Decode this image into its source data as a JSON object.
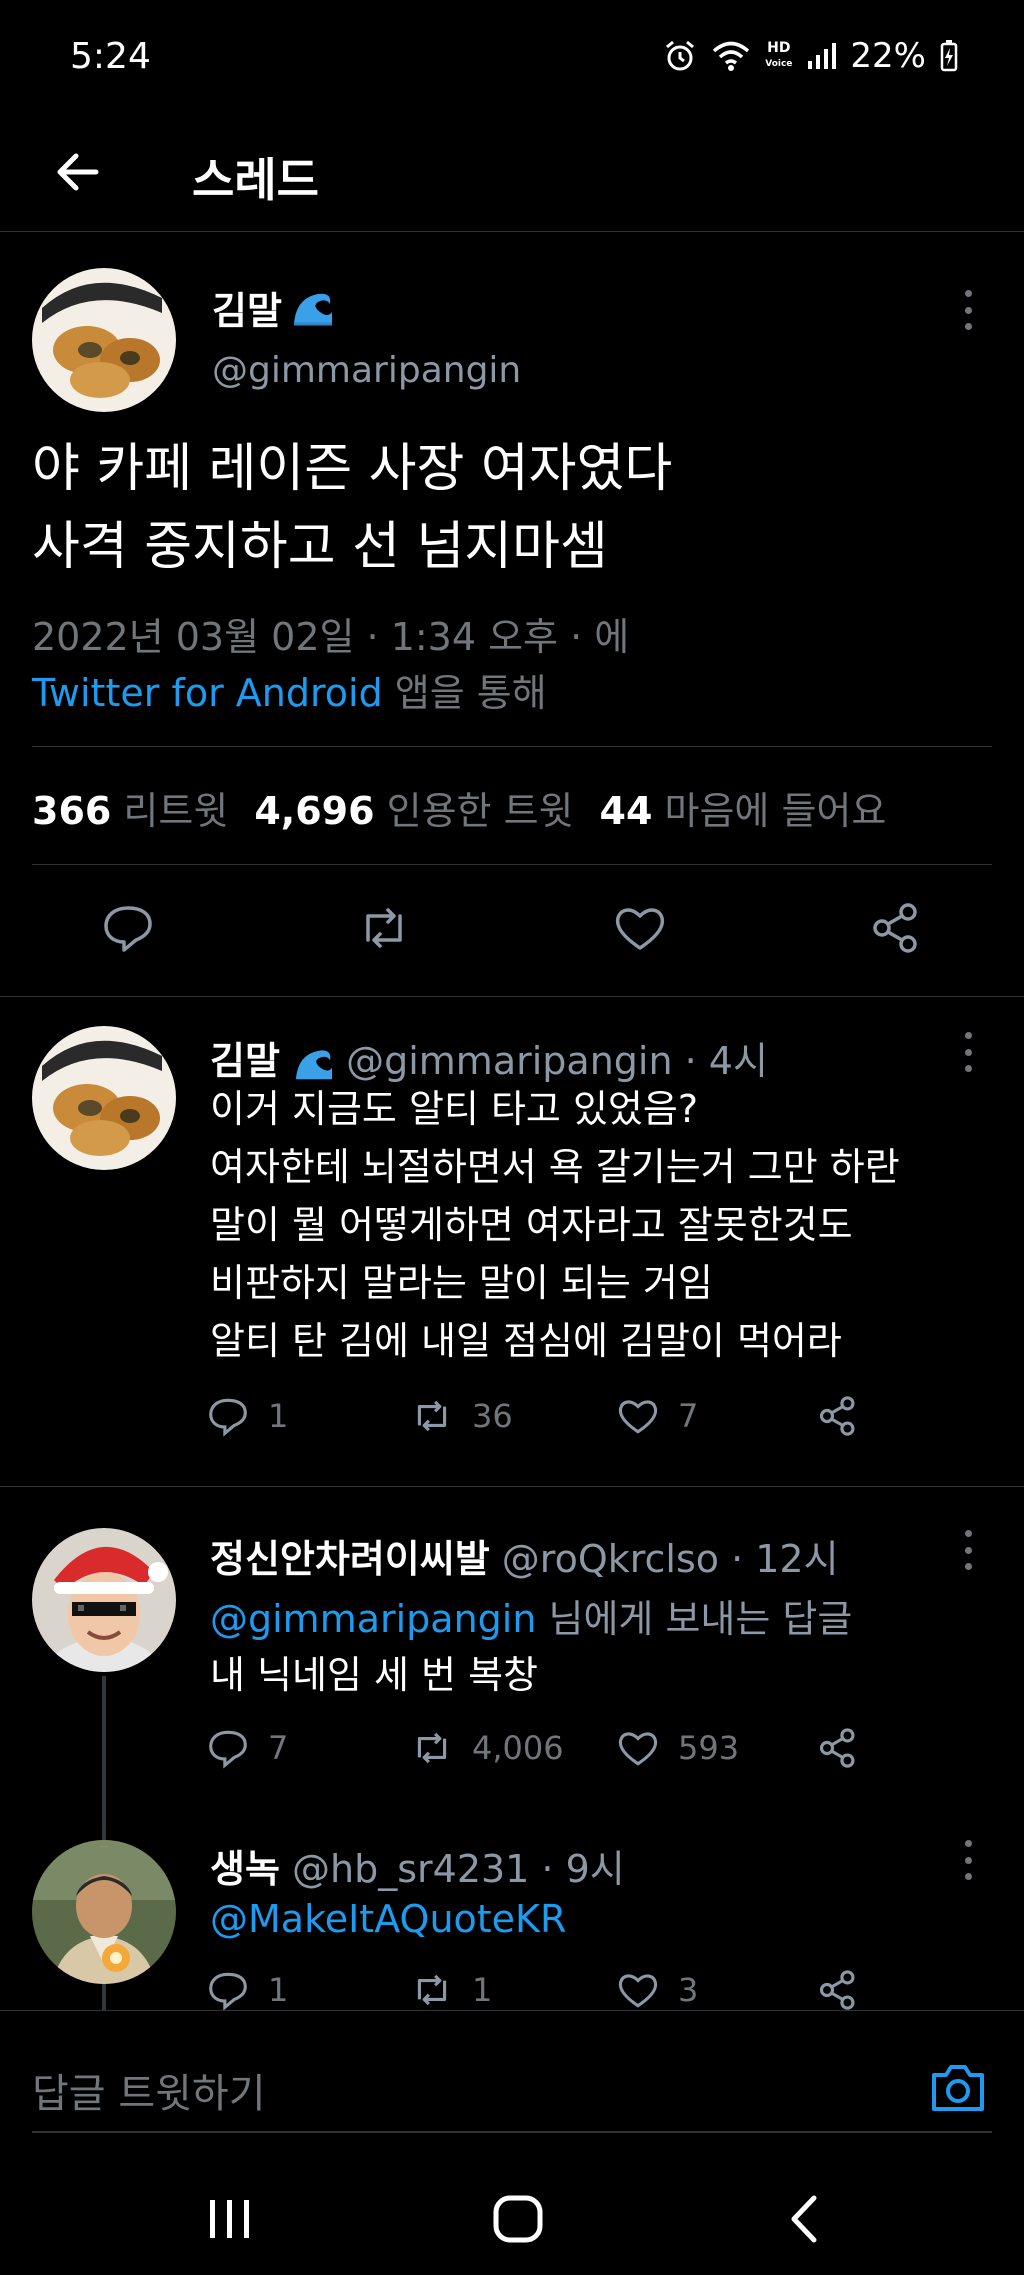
{
  "status_bar": {
    "time": "5:24",
    "hd_top": "HD",
    "hd_bottom": "Voice",
    "battery": "22%"
  },
  "header": {
    "title": "스레드"
  },
  "main_tweet": {
    "name": "김말",
    "handle": "@gimmaripangin",
    "text_line1": "야 카페 레이즌 사장 여자였다",
    "text_line2": "사격 중지하고 선 넘지마셈",
    "date": "2022년 03월 02일 · 1:34 오후 · 에",
    "source_link": "Twitter for Android",
    "source_suffix": " 앱을 통해",
    "retweets": "366",
    "retweets_label": "리트윗",
    "quotes": "4,696",
    "quotes_label": "인용한 트윗",
    "likes": "44",
    "likes_label": "마음에 들어요"
  },
  "replies": [
    {
      "name": "김말",
      "handle": "@gimmaripangin · 4시",
      "lines": [
        "이거 지금도 알티 타고 있었음?",
        "여자한테 뇌절하면서 욕 갈기는거 그만 하란",
        "말이 뭘 어떻게하면 여자라고 잘못한것도",
        "비판하지 말라는 말이 되는 거임",
        "알티 탄 김에 내일 점심에 김말이 먹어라"
      ],
      "reply_count": "1",
      "retweet_count": "36",
      "like_count": "7"
    },
    {
      "name": "정신안차려이씨발",
      "handle": "@roQkrclso · 12시",
      "reply_to_mention": "@gimmaripangin",
      "reply_to_suffix": " 님에게 보내는 답글",
      "lines": [
        "내 닉네임 세 번 복창"
      ],
      "reply_count": "7",
      "retweet_count": "4,006",
      "like_count": "593"
    },
    {
      "name": "생녹",
      "handle": "@hb_sr4231 · 9시",
      "mention": "@MakeItAQuoteKR",
      "reply_count": "1",
      "retweet_count": "1",
      "like_count": "3"
    }
  ],
  "reply_box": {
    "placeholder": "답글 트윗하기"
  },
  "colors": {
    "accent": "#1d9bf0",
    "background": "#000000",
    "secondary_text": "#71767b"
  },
  "icons": [
    "back-arrow-icon",
    "reply-icon",
    "retweet-icon",
    "like-icon",
    "share-icon",
    "camera-icon",
    "more-icon",
    "wave-emoji-icon"
  ]
}
